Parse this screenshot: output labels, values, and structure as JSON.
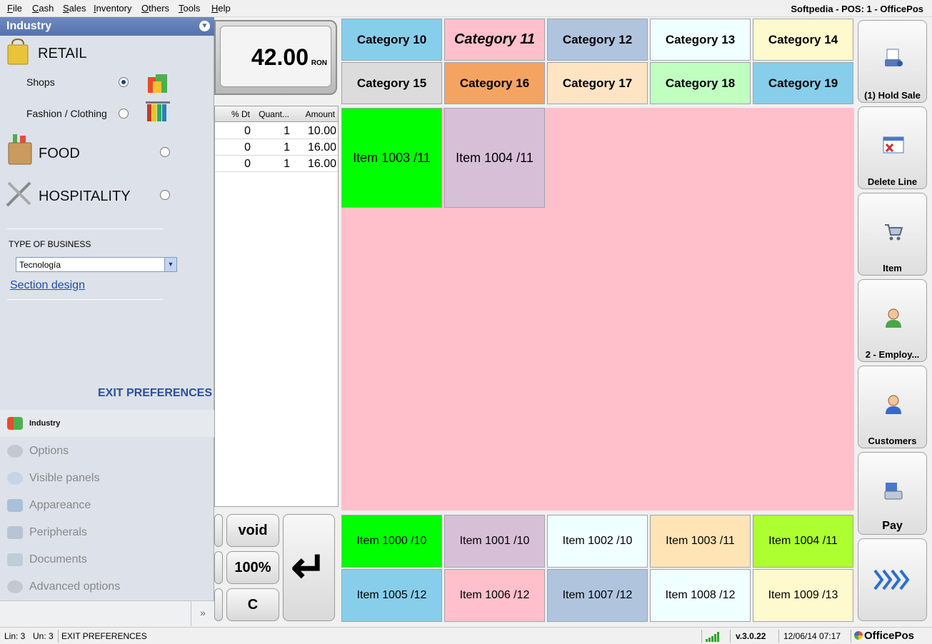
{
  "menu": [
    "File",
    "Cash",
    "Sales",
    "Inventory",
    "Others",
    "Tools",
    "Help"
  ],
  "window_title": "Softpedia - POS: 1 - OfficePos",
  "preferences": {
    "header": "Industry",
    "retail": "RETAIL",
    "shops": "Shops",
    "fashion": "Fashion / Clothing",
    "food": "FOOD",
    "hospitality": "HOSPITALITY",
    "selected": "Shops",
    "type_of_business_label": "TYPE OF BUSINESS",
    "type_of_business_value": "Tecnología",
    "section_design": "Section design",
    "exit": "EXIT PREFERENCES",
    "nav": [
      "Industry",
      "Options",
      "Visible panels",
      "Appareance",
      "Peripherals",
      "Documents",
      "Advanced options"
    ],
    "nav_more": "»"
  },
  "total": {
    "value": "42.00",
    "currency": "RON"
  },
  "lines": {
    "headers": [
      "% Dt",
      "Quant...",
      "Amount"
    ],
    "rows": [
      {
        "dt": "0",
        "qty": "1",
        "amount": "10.00"
      },
      {
        "dt": "0",
        "qty": "1",
        "amount": "16.00"
      },
      {
        "dt": "0",
        "qty": "1",
        "amount": "16.00"
      }
    ]
  },
  "keypad": {
    "void": "void",
    "percent": "100%",
    "clear": "C",
    "enter": "↵"
  },
  "categories": [
    {
      "label": "Category 10",
      "color": "#87ceeb"
    },
    {
      "label": "Category 11",
      "color": "#ffc0cb"
    },
    {
      "label": "Category 12",
      "color": "#b0c4de"
    },
    {
      "label": "Category 13",
      "color": "#f0ffff"
    },
    {
      "label": "Category 14",
      "color": "#fffacd"
    },
    {
      "label": "Category 15",
      "color": "#dcdcdc"
    },
    {
      "label": "Category 16",
      "color": "#f4a460"
    },
    {
      "label": "Category 17",
      "color": "#ffe4c4"
    },
    {
      "label": "Category 18",
      "color": "#c1ffc1"
    },
    {
      "label": "Category 19",
      "color": "#87ceeb"
    }
  ],
  "selected_category": "Category 11",
  "category_items": [
    {
      "label": "Item 1003 /11",
      "color": "#00ff00"
    },
    {
      "label": "Item 1004 /11",
      "color": "#d8bfd8"
    }
  ],
  "quick_items": [
    {
      "label": "Item 1000 /10",
      "color": "#00ff00"
    },
    {
      "label": "Item 1001 /10",
      "color": "#d8bfd8"
    },
    {
      "label": "Item 1002 /10",
      "color": "#f0ffff"
    },
    {
      "label": "Item 1003 /11",
      "color": "#ffe4b5"
    },
    {
      "label": "Item 1004 /11",
      "color": "#adff2f"
    },
    {
      "label": "Item 1005 /12",
      "color": "#87ceeb"
    },
    {
      "label": "Item 1006 /12",
      "color": "#ffc0cb"
    },
    {
      "label": "Item 1007 /12",
      "color": "#b0c4de"
    },
    {
      "label": "Item 1008 /12",
      "color": "#f0ffff"
    },
    {
      "label": "Item 1009 /13",
      "color": "#fffacd"
    }
  ],
  "actions": [
    {
      "label": "(1) Hold Sale",
      "icon": "printer-icon"
    },
    {
      "label": "Delete Line",
      "icon": "delete-line-icon"
    },
    {
      "label": "Item",
      "icon": "cart-icon"
    },
    {
      "label": "2 - Employ...",
      "icon": "employee-icon"
    },
    {
      "label": "Customers",
      "icon": "customer-icon"
    },
    {
      "label": "Pay",
      "icon": "cash-register-icon"
    },
    {
      "label": "",
      "icon": "forward-arrows-icon"
    }
  ],
  "status": {
    "lin": "Lin: 3",
    "un": "Un: 3",
    "message": "EXIT PREFERENCES",
    "version": "v.3.0.22",
    "datetime": "12/06/14 07:17",
    "brand": "OfficePos"
  }
}
